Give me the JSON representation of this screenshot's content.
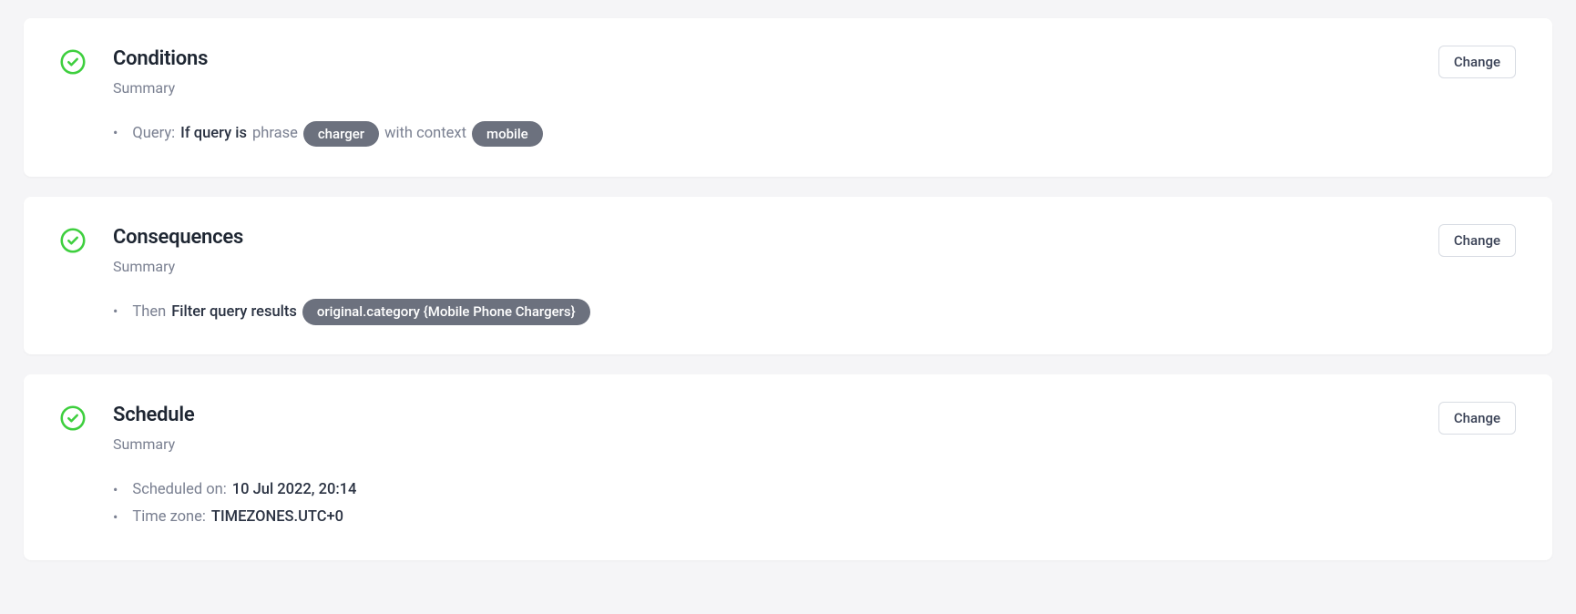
{
  "sections": {
    "conditions": {
      "title": "Conditions",
      "summary_label": "Summary",
      "change_label": "Change",
      "query_label": "Query:",
      "if_query_is": "If query is",
      "phrase": "phrase",
      "pill1": "charger",
      "with_context": "with context",
      "pill2": "mobile"
    },
    "consequences": {
      "title": "Consequences",
      "summary_label": "Summary",
      "change_label": "Change",
      "then": "Then",
      "action": "Filter query results",
      "pill": "original.category {Mobile Phone Chargers}"
    },
    "schedule": {
      "title": "Schedule",
      "summary_label": "Summary",
      "change_label": "Change",
      "scheduled_on_label": "Scheduled on:",
      "scheduled_on_value": "10 Jul 2022, 20:14",
      "timezone_label": "Time zone:",
      "timezone_value": "TIMEZONES.UTC+0"
    }
  },
  "colors": {
    "accent_green": "#3ecf3e",
    "pill_bg": "#6c717e"
  }
}
